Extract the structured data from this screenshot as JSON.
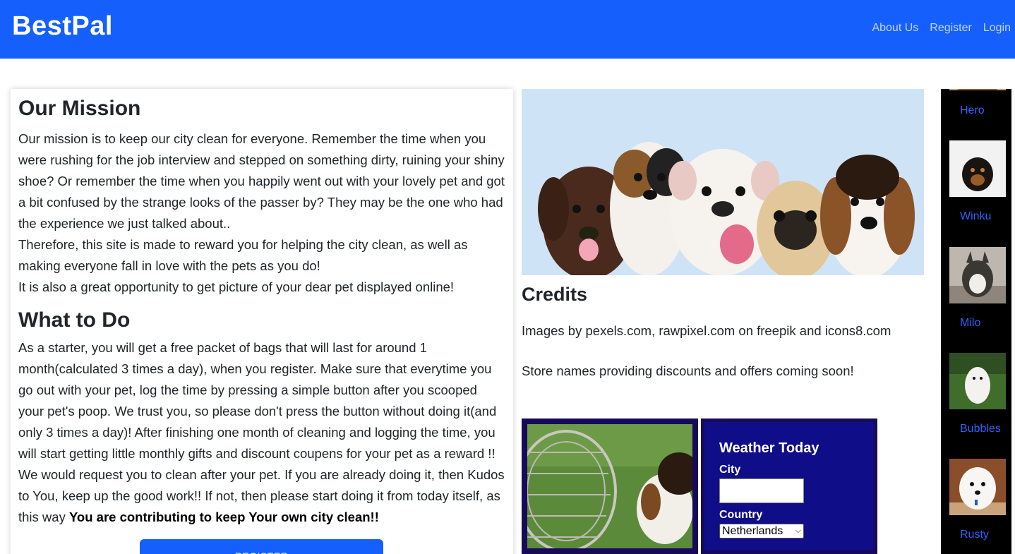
{
  "header": {
    "brand": "BestPal",
    "nav": [
      {
        "label": "About Us"
      },
      {
        "label": "Register"
      },
      {
        "label": "Login"
      }
    ]
  },
  "mission": {
    "title": "Our Mission",
    "paragraph1": "Our mission is to keep our city clean for everyone. Remember the time when you were rushing for the job interview and stepped on something dirty, ruining your shiny shoe? Or remember the time when you happily went out with your lovely pet and got a bit confused by the strange looks of the passer by? They may be the one who had the experience we just talked about..",
    "paragraph2": "Therefore, this site is made to reward you for helping the city clean, as well as making everyone fall in love with the pets as you do!",
    "paragraph3": "It is also a great opportunity to get picture of your dear pet displayed online!",
    "todo_title": "What to Do",
    "todo_text": "As a starter, you will get a free packet of bags that will last for around 1 month(calculated 3 times a day), when you register. Make sure that everytime you go out with your pet, log the time by pressing a simple button after you scooped your pet's poop. We trust you, so please don't press the button without doing it(and only 3 times a day)! After finishing one month of cleaning and logging the time, you will start getting little monthly gifts and discount coupens for your pet as a reward !! We would request you to clean after your pet. If you are already doing it, then Kudos to You, keep up the good work!! If not, then please start doing it from today itself, as this way",
    "todo_emphasis": "You are contributing to keep Your own city clean!!",
    "register_button": "REGISTER"
  },
  "credits": {
    "title": "Credits",
    "text": "Images by pexels.com, rawpixel.com on freepik and icons8.com",
    "stores": "Store names providing discounts and offers coming soon!"
  },
  "weather": {
    "title": "Weather Today",
    "city_label": "City",
    "city_value": "",
    "country_label": "Country",
    "country_selected": "Netherlands"
  },
  "sidebar": {
    "pets": [
      {
        "name": "Hero"
      },
      {
        "name": "Winku"
      },
      {
        "name": "Milo"
      },
      {
        "name": "Bubbles"
      },
      {
        "name": "Rusty"
      }
    ]
  },
  "colors": {
    "brand": "#1560fd",
    "weather_bg": "#0f0d87",
    "sidebar_bg": "#000000",
    "pet_link": "#2e62ff"
  }
}
